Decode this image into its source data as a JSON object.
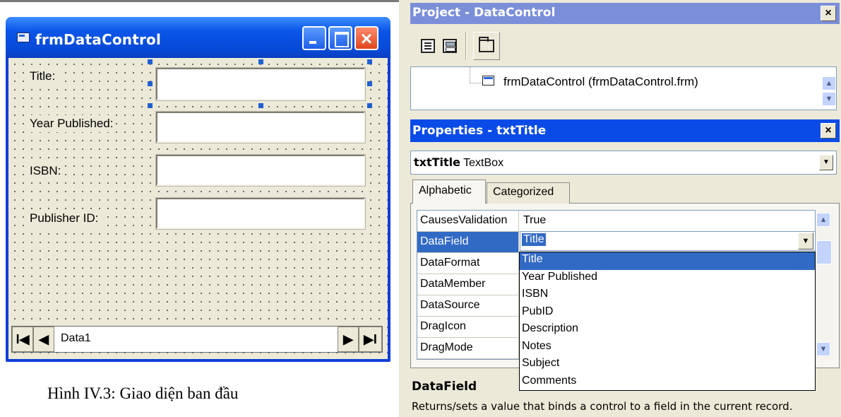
{
  "form": {
    "title": "frmDataControl",
    "labels": {
      "title": "Title:",
      "year": "Year Published:",
      "isbn": "ISBN:",
      "publisher": "Publisher ID:"
    },
    "data_control": {
      "caption": "Data1",
      "first": "I◀",
      "prev": "◀",
      "next": "▶",
      "last": "▶I"
    }
  },
  "figure_caption": "Hình IV.3: Giao diện ban đầu",
  "project": {
    "title": "Project - DataControl",
    "close": "×",
    "tree_item": "frmDataControl (frmDataControl.frm)"
  },
  "properties": {
    "title": "Properties - txtTitle",
    "close": "×",
    "object_name": "txtTitle",
    "object_type": "TextBox",
    "tabs": [
      "Alphabetic",
      "Categorized"
    ],
    "rows": [
      {
        "name": "CausesValidation",
        "value": "True"
      },
      {
        "name": "DataField",
        "value": "Title"
      },
      {
        "name": "DataFormat",
        "value": ""
      },
      {
        "name": "DataMember",
        "value": ""
      },
      {
        "name": "DataSource",
        "value": ""
      },
      {
        "name": "DragIcon",
        "value": ""
      },
      {
        "name": "DragMode",
        "value": ""
      }
    ],
    "selected_value": "Title",
    "dropdown_options": [
      "Title",
      "Year Published",
      "ISBN",
      "PubID",
      "Description",
      "Notes",
      "Subject",
      "Comments"
    ],
    "dropdown_selected": "Title",
    "description_title": "DataField",
    "description_text": "Returns/sets a value that binds a control to a field in the current record."
  },
  "colors": {
    "xp_title_blue": "#0a4be8",
    "inactive_title": "#7b8fd9",
    "selection": "#316ac5",
    "face": "#ece9d8"
  }
}
